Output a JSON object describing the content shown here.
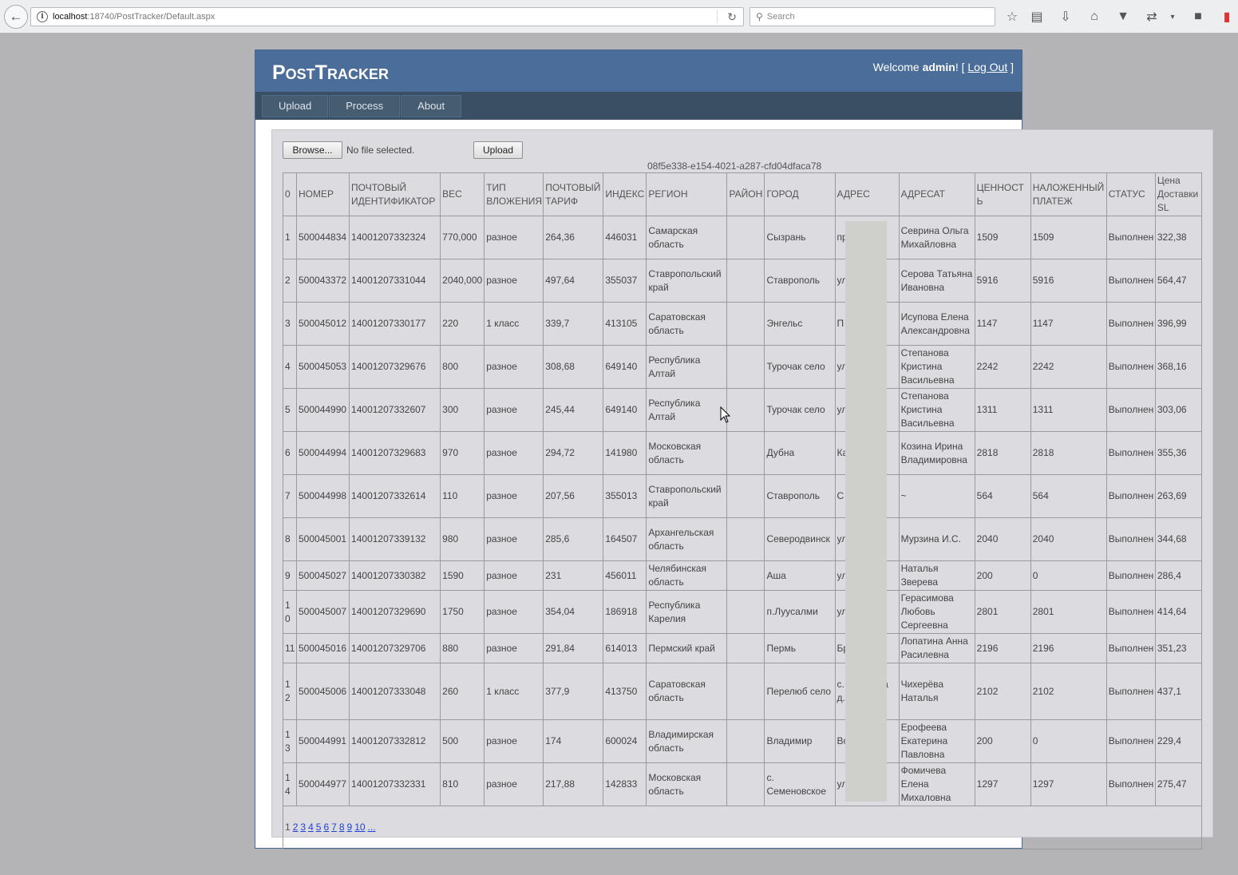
{
  "browser": {
    "url_host": "localhost",
    "url_rest": ":18740/PostTracker/Default.aspx",
    "search_placeholder": "Search"
  },
  "site": {
    "title": "PostTracker",
    "welcome": "Welcome",
    "user": "admin",
    "punct_open": "! [",
    "logout": "Log Out",
    "punct_close": "]"
  },
  "menu": [
    {
      "label": "Upload"
    },
    {
      "label": "Process"
    },
    {
      "label": "About"
    }
  ],
  "form": {
    "browse_label": "Browse...",
    "file_status": "No file selected.",
    "upload_label": "Upload",
    "guid": "08f5e338-e154-4021-a287-cfd04dfaca78"
  },
  "grid": {
    "headers": [
      "0",
      "НОМЕР",
      "ПОЧТОВЫЙ ИДЕНТИФИКАТОР",
      "ВЕС",
      "ТИП ВЛОЖЕНИЯ",
      "ПОЧТОВЫЙ ТАРИФ",
      "ИНДЕКС",
      "РЕГИОН",
      "РАЙОН",
      "ГОРОД",
      "АДРЕС",
      "АДРЕСАТ",
      "ЦЕННОСТЬ",
      "НАЛОЖЕННЫЙ ПЛАТЕЖ",
      "СТАТУС",
      "Цена Доставки SL"
    ],
    "rows": [
      [
        "1",
        "500044834",
        "14001207332324",
        "770,000",
        "разное",
        "264,36",
        "446031",
        "Самарская область",
        "",
        "Сызрань",
        "пр о кв 68",
        "Севрина Ольга Михайловна",
        "1509",
        "1509",
        "Выполнен",
        "322,38"
      ],
      [
        "2",
        "500043372",
        "14001207331044",
        "2040,000",
        "разное",
        "497,64",
        "355037",
        "Ставропольский край",
        "",
        "Ставрополь",
        "ул М а 65",
        "Серова Татьяна Ивановна",
        "5916",
        "5916",
        "Выполнен",
        "564,47"
      ],
      [
        "3",
        "500045012",
        "14001207330177",
        "220",
        "1 класс",
        "339,7",
        "413105",
        "Саратовская область",
        "",
        "Энгельс",
        "П Э д 3",
        "Исупова Елена Александровна",
        "1147",
        "1147",
        "Выполнен",
        "396,99"
      ],
      [
        "4",
        "500045053",
        "14001207329676",
        "800",
        "разное",
        "308,68",
        "649140",
        "Республика Алтай",
        "",
        "Турочак село",
        "ул ая, д.",
        "Степанова Кристина Васильевна",
        "2242",
        "2242",
        "Выполнен",
        "368,16"
      ],
      [
        "5",
        "500044990",
        "14001207332607",
        "300",
        "разное",
        "245,44",
        "649140",
        "Республика Алтай",
        "",
        "Турочак село",
        "ул ая, д.",
        "Степанова Кристина Васильевна",
        "1311",
        "1311",
        "Выполнен",
        "303,06"
      ],
      [
        "6",
        "500044994",
        "14001207329683",
        "970",
        "разное",
        "294,72",
        "141980",
        "Московская область",
        "",
        "Дубна",
        "Ка М а, 29",
        "Козина Ирина Владимировна",
        "2818",
        "2818",
        "Выполнен",
        "355,36"
      ],
      [
        "7",
        "500044998",
        "14001207332614",
        "110",
        "разное",
        "207,56",
        "355013",
        "Ставропольский край",
        "",
        "Ставрополь",
        "С 48 кв 5",
        "~",
        "564",
        "564",
        "Выполнен",
        "263,69"
      ],
      [
        "8",
        "500045001",
        "14001207339132",
        "980",
        "разное",
        "285,6",
        "164507",
        "Архангельская область",
        "",
        "Северодвинск",
        "ул С д.",
        "Мурзина И.С.",
        "2040",
        "2040",
        "Выполнен",
        "344,68"
      ],
      [
        "9",
        "500045027",
        "14001207330382",
        "1590",
        "разное",
        "231",
        "456011",
        "Челябинская область",
        "",
        "Аша",
        "ул по 3",
        "Наталья Зверева",
        "200",
        "0",
        "Выполнен",
        "286,4"
      ],
      [
        "10",
        "500045007",
        "14001207329690",
        "1750",
        "разное",
        "354,04",
        "186918",
        "Республика Карелия",
        "",
        "п.Луусалми",
        "ул С д",
        "Герасимова Любовь Сергеевна",
        "2801",
        "2801",
        "Выполнен",
        "414,64"
      ],
      [
        "11",
        "500045016",
        "14001207329706",
        "880",
        "разное",
        "291,84",
        "614013",
        "Пермский край",
        "",
        "Пермь",
        "Бр д.",
        "Лопатина Анна Расилевна",
        "2196",
        "2196",
        "Выполнен",
        "351,23"
      ],
      [
        "12",
        "500045006",
        "14001207333048",
        "260",
        "1 класс",
        "377,9",
        "413750",
        "Саратовская область",
        "",
        "Перелюб село",
        "с. б ул П на д.",
        "Чихерёва Наталья",
        "2102",
        "2102",
        "Выполнен",
        "437,1"
      ],
      [
        "13",
        "500044991",
        "14001207332812",
        "500",
        "разное",
        "174",
        "600024",
        "Владимирская область",
        "",
        "Владимир",
        "Во Д д. 17",
        "Ерофеева Екатерина Павловна",
        "200",
        "0",
        "Выполнен",
        "229,4"
      ],
      [
        "14",
        "500044977",
        "14001207332331",
        "810",
        "разное",
        "217,88",
        "142833",
        "Московская область",
        "",
        "с. Семеновское",
        "ул Ц д.",
        "Фомичева Елена Михаловна",
        "1297",
        "1297",
        "Выполнен",
        "275,47"
      ]
    ],
    "pager": {
      "current": "1",
      "pages": [
        "2",
        "3",
        "4",
        "5",
        "6",
        "7",
        "8",
        "9",
        "10",
        "..."
      ]
    }
  }
}
